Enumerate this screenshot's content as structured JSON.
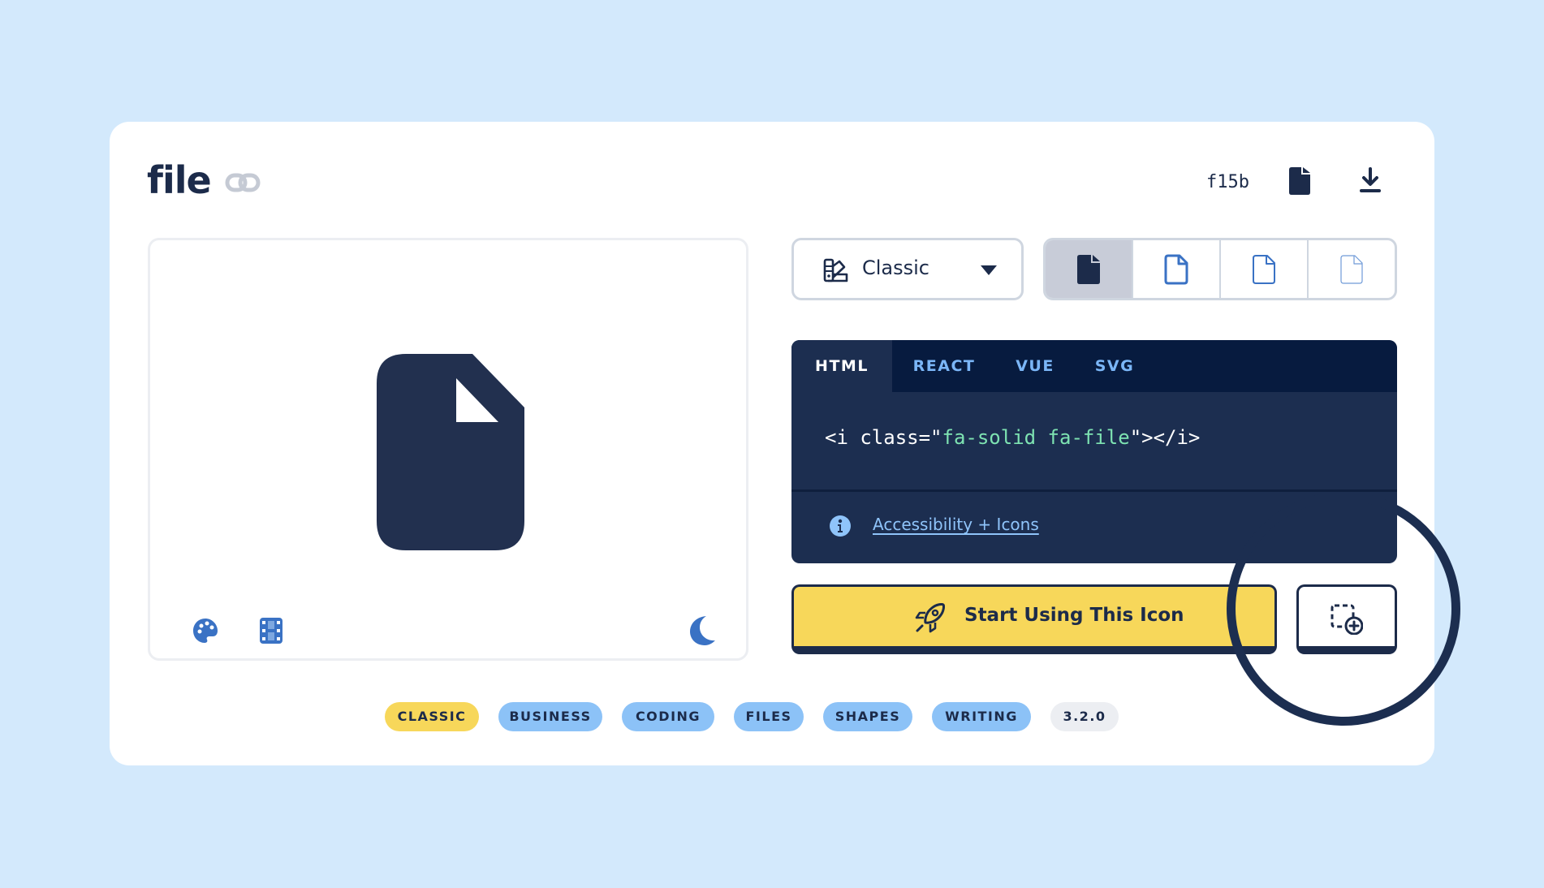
{
  "icon": {
    "name": "file",
    "unicode": "f15b"
  },
  "style_select": {
    "value": "Classic"
  },
  "variants": [
    {
      "name": "solid",
      "active": true
    },
    {
      "name": "regular",
      "active": false
    },
    {
      "name": "light",
      "active": false
    },
    {
      "name": "thin",
      "active": false
    }
  ],
  "code": {
    "tabs": [
      "HTML",
      "REACT",
      "VUE",
      "SVG"
    ],
    "active_tab": "HTML",
    "snippet_prefix": "<i class=\"",
    "snippet_class": "fa-solid fa-file",
    "snippet_suffix": "\"></i>",
    "accessibility_link": "Accessibility + Icons"
  },
  "actions": {
    "start_label": "Start Using This Icon"
  },
  "tags": [
    "CLASSIC",
    "BUSINESS",
    "CODING",
    "FILES",
    "SHAPES",
    "WRITING",
    "3.2.0"
  ],
  "colors": {
    "background": "#d3e9fc",
    "navy": "#1c2b4a",
    "accent_blue": "#3a72c4",
    "yellow": "#f7d75a",
    "tag_blue": "#8cc2f7",
    "code_string": "#7ee3b2"
  }
}
